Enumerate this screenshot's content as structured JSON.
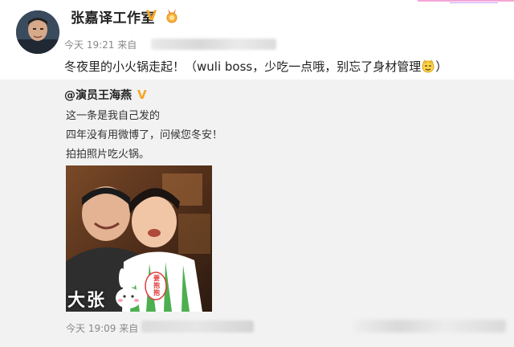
{
  "post": {
    "author": "张嘉译工作室",
    "time": "今天 19:21 来自",
    "text_prefix": "冬夜里的小火锅走起！（wuli boss，少吃一点哦，别忘了身材管理",
    "text_suffix": "）"
  },
  "repost": {
    "user": "@演员王海燕",
    "lines": [
      "这一条是我自己发的",
      "四年没有用微博了，问候您冬安！",
      "拍拍照片吃火锅。"
    ],
    "time": "今天 19:09 来自",
    "photo_caption_left": "大张",
    "photo_sign": "要抱抱"
  },
  "colors": {
    "badge": "#f5a623",
    "link": "#eb7350",
    "meta": "#888888",
    "repost_bg": "#f2f2f2"
  }
}
